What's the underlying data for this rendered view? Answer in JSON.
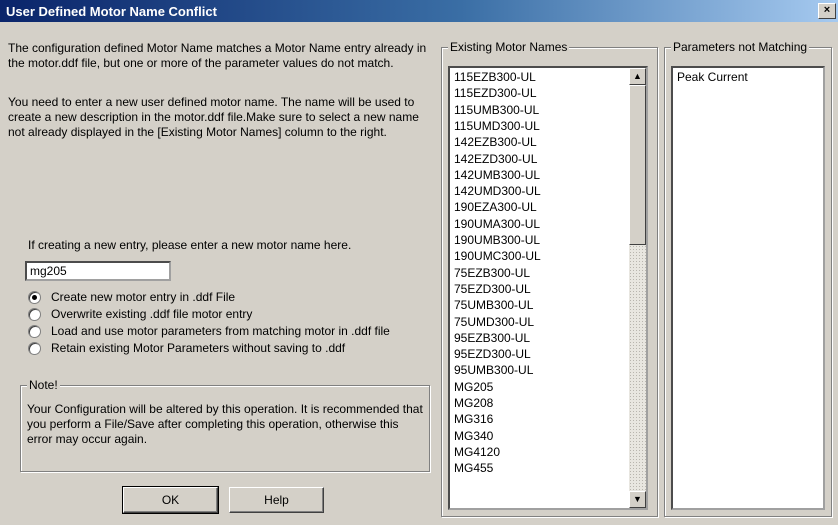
{
  "window": {
    "title": "User Defined Motor Name Conflict",
    "close_glyph": "×"
  },
  "text": {
    "para1": "The configuration defined Motor Name matches a Motor Name entry already in the motor.ddf file, but one or more of the parameter values do not match.",
    "para2": "You need to enter a new user defined motor name.  The name will be used to create a new description in the motor.ddf file.Make sure to select a new name not already displayed in the [Existing Motor Names] column to the right.",
    "prompt": "If creating a new entry, please enter a new motor name here."
  },
  "motor_name_input": {
    "value": "mg205"
  },
  "options": [
    {
      "label": "Create new motor entry in .ddf File",
      "selected": true
    },
    {
      "label": "Overwrite existing .ddf file motor entry",
      "selected": false
    },
    {
      "label": "Load and use motor parameters from matching motor in .ddf file",
      "selected": false
    },
    {
      "label": "Retain existing Motor Parameters without saving to .ddf",
      "selected": false
    }
  ],
  "note": {
    "legend": "Note!",
    "body": "Your Configuration will be altered by this operation. It is recommended that you perform a File/Save after completing this operation, otherwise this error may occur again."
  },
  "buttons": {
    "ok": "OK",
    "help": "Help"
  },
  "existing_motors": {
    "legend": "Existing Motor Names",
    "items": [
      "115EZB300-UL",
      "115EZD300-UL",
      "115UMB300-UL",
      "115UMD300-UL",
      "142EZB300-UL",
      "142EZD300-UL",
      "142UMB300-UL",
      "142UMD300-UL",
      "190EZA300-UL",
      "190UMA300-UL",
      "190UMB300-UL",
      "190UMC300-UL",
      "75EZB300-UL",
      "75EZD300-UL",
      "75UMB300-UL",
      "75UMD300-UL",
      "95EZB300-UL",
      "95EZD300-UL",
      "95UMB300-UL",
      "MG205",
      "MG208",
      "MG316",
      "MG340",
      "MG4120",
      "MG455"
    ],
    "scroll_up": "▲",
    "scroll_down": "▼"
  },
  "params_not_matching": {
    "legend": "Parameters not Matching",
    "items": [
      "Peak Current"
    ]
  }
}
